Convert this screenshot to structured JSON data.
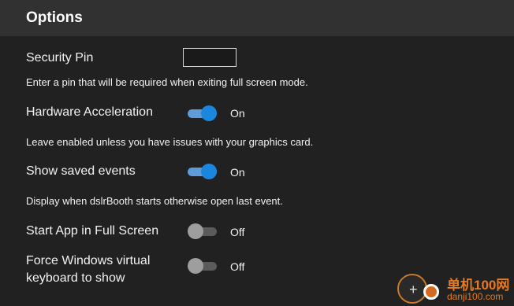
{
  "header": {
    "title": "Options"
  },
  "security_pin": {
    "label": "Security Pin",
    "value": "",
    "hint": "Enter a pin that will be required when exiting full screen mode."
  },
  "hardware_acceleration": {
    "label": "Hardware Acceleration",
    "enabled": true,
    "state": "On",
    "hint": "Leave enabled unless you have issues with your graphics card."
  },
  "show_saved_events": {
    "label": "Show saved events",
    "enabled": true,
    "state": "On",
    "hint": "Display when dslrBooth starts otherwise open last event."
  },
  "start_full_screen": {
    "label": "Start App in Full Screen",
    "enabled": false,
    "state": "Off"
  },
  "force_keyboard": {
    "label_line1": "Force Windows virtual",
    "label_line2": "keyboard to show",
    "enabled": false,
    "state": "Off"
  },
  "watermark": {
    "title": "单机100网",
    "url": "danji100.com"
  },
  "colors": {
    "background": "#212121",
    "header": "#313131",
    "toggle_on": "#1b86dd",
    "toggle_off": "#9e9e9e",
    "watermark": "#e67a21"
  }
}
